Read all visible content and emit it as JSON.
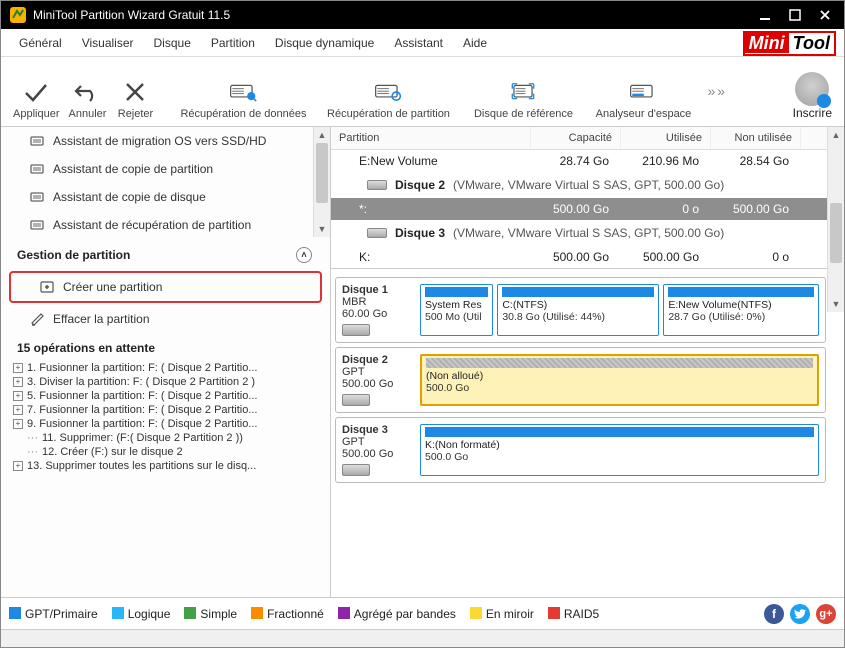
{
  "title": "MiniTool Partition Wizard Gratuit 11.5",
  "brand": {
    "left": "Mini",
    "right": "Tool"
  },
  "menus": [
    "Général",
    "Visualiser",
    "Disque",
    "Partition",
    "Disque dynamique",
    "Assistant",
    "Aide"
  ],
  "toolbar": {
    "apply": "Appliquer",
    "undo": "Annuler",
    "discard": "Rejeter",
    "data_recovery": "Récupération de données",
    "partition_recovery": "Récupération de partition",
    "benchmark": "Disque de référence",
    "space_analyzer": "Analyseur d'espace",
    "subscribe": "Inscrire"
  },
  "sidebar": {
    "wizards": [
      "Assistant de migration OS vers SSD/HD",
      "Assistant de copie de partition",
      "Assistant de copie de disque",
      "Assistant de récupération de partition"
    ],
    "partition_mgmt_header": "Gestion de partition",
    "partition_mgmt": [
      "Créer une partition",
      "Effacer la partition"
    ],
    "highlight_index": 0,
    "pending_header": "15 opérations en attente",
    "pending": [
      "1. Fusionner la partition: F: ( Disque 2 Partitio...",
      "3. Diviser la partition: F: ( Disque 2 Partition 2 )",
      "5. Fusionner la partition: F: ( Disque 2 Partitio...",
      "7. Fusionner la partition: F: ( Disque 2 Partitio...",
      "9. Fusionner la partition: F: ( Disque 2 Partitio...",
      "11. Supprimer: (F:( Disque 2 Partition 2 ))",
      "12. Créer (F:) sur le disque 2",
      "13. Supprimer toutes les partitions sur le disq..."
    ],
    "pending_expandable": [
      true,
      true,
      true,
      true,
      true,
      false,
      false,
      true
    ]
  },
  "table": {
    "headers": {
      "partition": "Partition",
      "capacity": "Capacité",
      "used": "Utilisée",
      "free": "Non utilisée"
    },
    "rows": [
      {
        "type": "partition",
        "name": "E:New Volume",
        "capacity": "28.74 Go",
        "used": "210.96 Mo",
        "free": "28.54 Go",
        "selected": false
      },
      {
        "type": "disk",
        "name": "Disque 2",
        "desc": "(VMware, VMware Virtual S SAS, GPT, 500.00 Go)"
      },
      {
        "type": "partition",
        "name": "*:",
        "capacity": "500.00 Go",
        "used": "0 o",
        "free": "500.00 Go",
        "selected": true
      },
      {
        "type": "disk",
        "name": "Disque 3",
        "desc": "(VMware, VMware Virtual S SAS, GPT, 500.00 Go)"
      },
      {
        "type": "partition",
        "name": "K:",
        "capacity": "500.00 Go",
        "used": "500.00 Go",
        "free": "0 o",
        "selected": false
      }
    ]
  },
  "disks": [
    {
      "name": "Disque 1",
      "scheme": "MBR",
      "size": "60.00 Go",
      "parts": [
        {
          "label": "System Res",
          "detail": "500 Mo (Util",
          "flex": 1,
          "style": "primary"
        },
        {
          "label": "C:(NTFS)",
          "detail": "30.8 Go (Utilisé: 44%)",
          "flex": 2.4,
          "style": "primary"
        },
        {
          "label": "E:New Volume(NTFS)",
          "detail": "28.7 Go (Utilisé: 0%)",
          "flex": 2.3,
          "style": "primary"
        }
      ]
    },
    {
      "name": "Disque 2",
      "scheme": "GPT",
      "size": "500.00 Go",
      "parts": [
        {
          "label": "(Non alloué)",
          "detail": "500.0 Go",
          "flex": 1,
          "style": "unalloc"
        }
      ]
    },
    {
      "name": "Disque 3",
      "scheme": "GPT",
      "size": "500.00 Go",
      "parts": [
        {
          "label": "K:(Non formaté)",
          "detail": "500.0 Go",
          "flex": 1,
          "style": "primary"
        }
      ]
    }
  ],
  "legend": [
    {
      "label": "GPT/Primaire",
      "color": "#1e88e5"
    },
    {
      "label": "Logique",
      "color": "#29b6f6"
    },
    {
      "label": "Simple",
      "color": "#43a047"
    },
    {
      "label": "Fractionné",
      "color": "#fb8c00"
    },
    {
      "label": "Agrégé par bandes",
      "color": "#8e24aa"
    },
    {
      "label": "En miroir",
      "color": "#fdd835"
    },
    {
      "label": "RAID5",
      "color": "#e53935"
    }
  ]
}
